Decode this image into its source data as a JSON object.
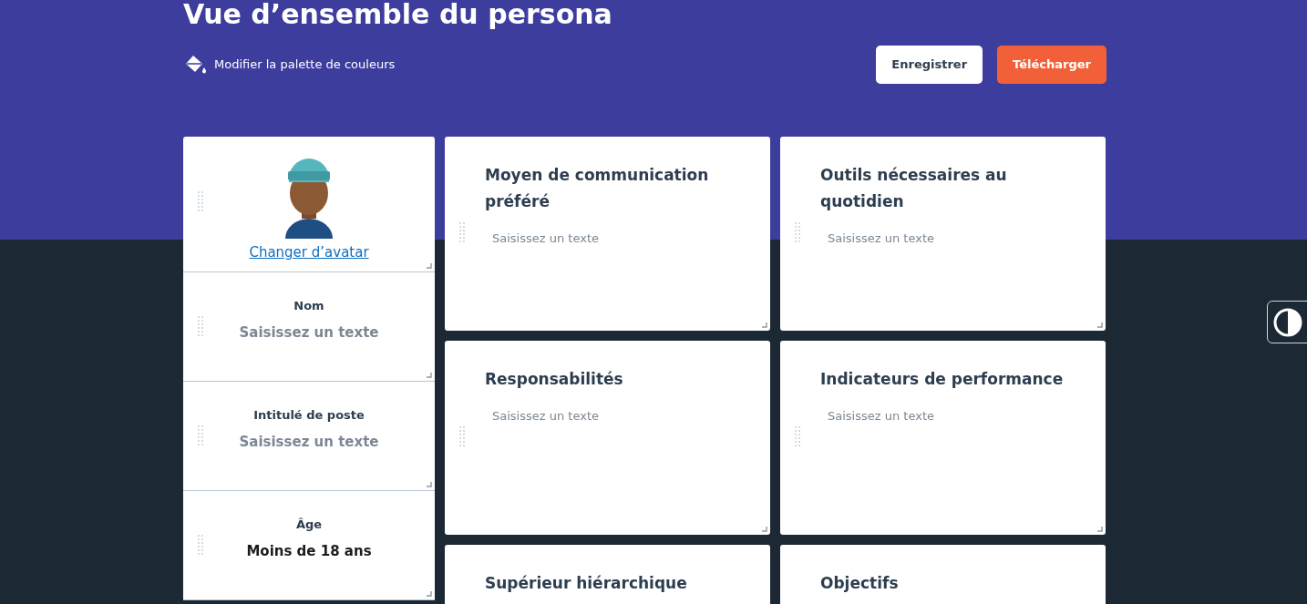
{
  "title": "Vue d’ensemble du persona",
  "palette_link": "Modifier la palette de couleurs",
  "buttons": [
    {
      "label": "Enregistrer",
      "kind": "secondary"
    },
    {
      "label": "Télécharger",
      "kind": "primary"
    }
  ],
  "profile": {
    "avatar_link": "Changer d’avatar",
    "fields": [
      {
        "label": "Nom",
        "text": "Saisissez un texte",
        "kind": "placeholder"
      },
      {
        "label": "Intitulé de poste",
        "text": "Saisissez un texte",
        "kind": "placeholder"
      },
      {
        "label": "Âge",
        "text": "Moins de 18 ans",
        "kind": "value"
      }
    ]
  },
  "sections": [
    {
      "title": "Moyen de communication préféré",
      "placeholder": "Saisissez un texte"
    },
    {
      "title": "Outils nécessaires au quotidien",
      "placeholder": "Saisissez un texte"
    },
    {
      "title": "Responsabilités",
      "placeholder": "Saisissez un texte"
    },
    {
      "title": "Indicateurs de performance",
      "placeholder": "Saisissez un texte"
    },
    {
      "title": "Supérieur hiérarchique"
    },
    {
      "title": "Objectifs"
    }
  ]
}
